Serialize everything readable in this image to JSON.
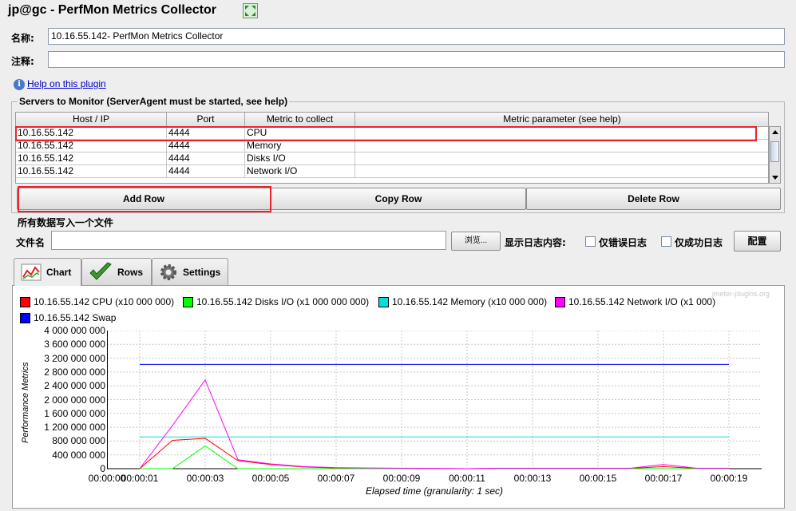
{
  "window": {
    "title": "jp@gc - PerfMon Metrics Collector"
  },
  "form": {
    "name_label": "名称:",
    "name_value": "10.16.55.142- PerfMon Metrics Collector",
    "comment_label": "注释:",
    "comment_value": ""
  },
  "help": {
    "link": "Help on this plugin"
  },
  "servers": {
    "group_title": "Servers to Monitor (ServerAgent must be started, see help)",
    "columns": [
      "Host / IP",
      "Port",
      "Metric to collect",
      "Metric parameter (see help)"
    ],
    "rows": [
      {
        "host": "10.16.55.142",
        "port": "4444",
        "metric": "CPU",
        "param": ""
      },
      {
        "host": "10.16.55.142",
        "port": "4444",
        "metric": "Memory",
        "param": ""
      },
      {
        "host": "10.16.55.142",
        "port": "4444",
        "metric": "Disks I/O",
        "param": ""
      },
      {
        "host": "10.16.55.142",
        "port": "4444",
        "metric": "Network I/O",
        "param": ""
      }
    ],
    "add_row": "Add Row",
    "copy_row": "Copy Row",
    "delete_row": "Delete Row"
  },
  "file": {
    "section_label": "所有数据写入一个文件",
    "filename_label": "文件名",
    "filename_value": "",
    "browse": "浏览...",
    "log_label": "显示日志内容:",
    "errors_only": "仅错误日志",
    "success_only": "仅成功日志",
    "configure": "配置"
  },
  "tabs": [
    {
      "label": "Chart",
      "icon": "chart-icon",
      "active": true
    },
    {
      "label": "Rows",
      "icon": "checkmark-icon",
      "active": false
    },
    {
      "label": "Settings",
      "icon": "gear-icon",
      "active": false
    }
  ],
  "watermark": "jmeter-plugins.org",
  "chart_data": {
    "type": "line",
    "title": "",
    "xlabel": "Elapsed time (granularity: 1 sec)",
    "ylabel": "Performance Metrics",
    "ylim": [
      0,
      4000000000
    ],
    "yticks": [
      "4 000 000 000",
      "3 600 000 000",
      "3 200 000 000",
      "2 800 000 000",
      "2 400 000 000",
      "2 000 000 000",
      "1 600 000 000",
      "1 200 000 000",
      "800 000 000",
      "400 000 000",
      "0"
    ],
    "xticks": [
      "00:00:00",
      "00:00:01",
      "00:00:03",
      "00:00:05",
      "00:00:07",
      "00:00:09",
      "00:00:11",
      "00:00:13",
      "00:00:15",
      "00:00:17",
      "00:00:19"
    ],
    "grid": true,
    "legend_position": "top",
    "series": [
      {
        "name": "10.16.55.142 CPU (x10 000 000)",
        "color": "#ff0000",
        "x": [
          1,
          2,
          3,
          4,
          5,
          6,
          7,
          8,
          9,
          10,
          11,
          12,
          13,
          14,
          15,
          16,
          17,
          18,
          19
        ],
        "y": [
          0,
          820000000,
          880000000,
          230000000,
          120000000,
          50000000,
          20000000,
          10000000,
          10000000,
          5000000,
          0,
          10000000,
          10000000,
          10000000,
          10000000,
          10000000,
          60000000,
          10000000,
          10000000
        ]
      },
      {
        "name": "10.16.55.142 Disks I/O (x1 000 000 000)",
        "color": "#00ff00",
        "x": [
          1,
          2,
          3,
          4,
          5,
          6,
          7,
          8,
          9,
          10,
          11,
          12,
          13,
          14,
          15,
          16,
          17,
          18,
          19
        ],
        "y": [
          0,
          0,
          660000000,
          0,
          0,
          0,
          0,
          0,
          0,
          0,
          0,
          0,
          0,
          0,
          0,
          0,
          0,
          0,
          0
        ]
      },
      {
        "name": "10.16.55.142 Memory (x10 000 000)",
        "color": "#00e0e0",
        "x": [
          1,
          19
        ],
        "y": [
          920000000,
          920000000
        ]
      },
      {
        "name": "10.16.55.142 Network I/O (x1 000)",
        "color": "#ff00ff",
        "x": [
          1,
          2,
          3,
          4,
          5,
          6,
          7,
          8,
          9,
          10,
          11,
          12,
          13,
          14,
          15,
          16,
          17,
          18,
          19
        ],
        "y": [
          0,
          1250000000,
          2570000000,
          260000000,
          140000000,
          60000000,
          30000000,
          20000000,
          15000000,
          10000000,
          0,
          15000000,
          15000000,
          15000000,
          15000000,
          15000000,
          120000000,
          15000000,
          15000000
        ]
      },
      {
        "name": "10.16.55.142 Swap",
        "color": "#0000ff",
        "x": [
          1,
          19
        ],
        "y": [
          3020000000,
          3020000000
        ]
      }
    ]
  }
}
